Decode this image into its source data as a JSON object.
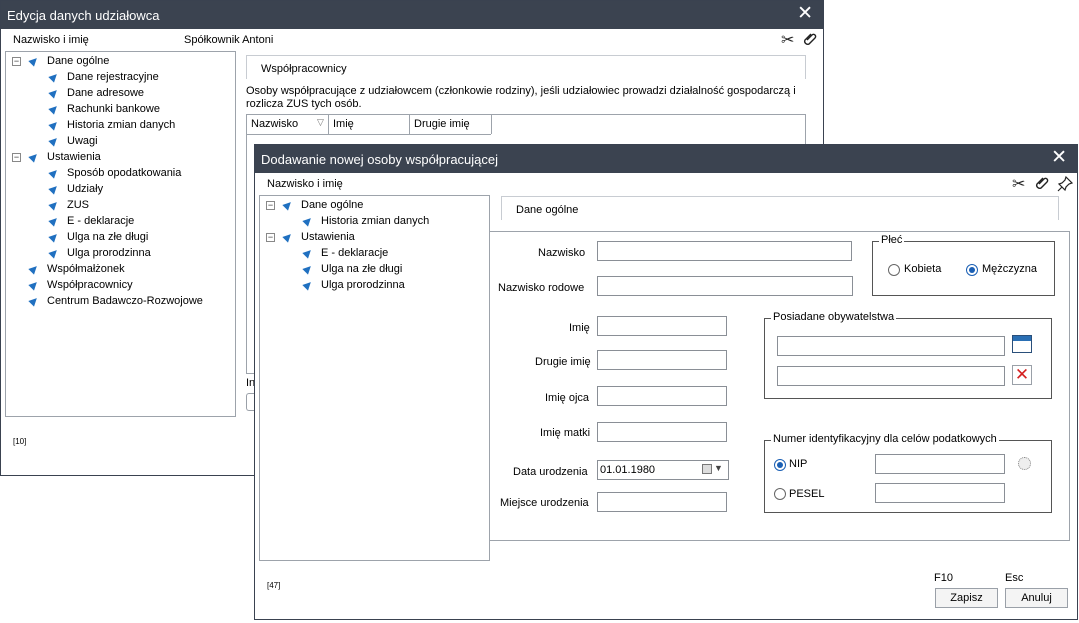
{
  "back_window": {
    "title": "Edycja danych udziałowca",
    "header_label": "Nazwisko i imię",
    "header_value": "Spółkownik Antoni",
    "tree": [
      {
        "label": "Dane ogólne",
        "level": 0
      },
      {
        "label": "Dane rejestracyjne",
        "level": 1
      },
      {
        "label": "Dane adresowe",
        "level": 1
      },
      {
        "label": "Rachunki bankowe",
        "level": 1
      },
      {
        "label": "Historia zmian danych",
        "level": 1
      },
      {
        "label": "Uwagi",
        "level": 1
      },
      {
        "label": "Ustawienia",
        "level": 0
      },
      {
        "label": "Sposób opodatkowania",
        "level": 1
      },
      {
        "label": "Udziały",
        "level": 1
      },
      {
        "label": "ZUS",
        "level": 1
      },
      {
        "label": "E - deklaracje",
        "level": 1
      },
      {
        "label": "Ulga na złe długi",
        "level": 1
      },
      {
        "label": "Ulga prorodzinna",
        "level": 1
      },
      {
        "label": "Współmałżonek",
        "level": 0
      },
      {
        "label": "Współpracownicy",
        "level": 0
      },
      {
        "label": "Centrum Badawczo-Rozwojowe",
        "level": 0
      }
    ],
    "tab_label": "Współpracownicy",
    "description_line1": "Osoby współpracujące z udziałowcem (członkowie rodziny), jeśli udziałowiec prowadzi działalność gospodarczą i",
    "description_line2": "rozlicza ZUS tych osób.",
    "columns": [
      "Nazwisko",
      "Imię",
      "Drugie imię"
    ],
    "truncated_text": "In",
    "status_code": "[10]"
  },
  "front_window": {
    "title": "Dodawanie nowej osoby współpracującej",
    "header_label": "Nazwisko i imię",
    "tree": [
      {
        "label": "Dane ogólne",
        "level": 0
      },
      {
        "label": "Historia zmian danych",
        "level": 1
      },
      {
        "label": "Ustawienia",
        "level": 0
      },
      {
        "label": "E - deklaracje",
        "level": 1
      },
      {
        "label": "Ulga na złe długi",
        "level": 1
      },
      {
        "label": "Ulga prorodzinna",
        "level": 1
      }
    ],
    "tab_label": "Dane ogólne",
    "fields": {
      "nazwisko": {
        "label": "Nazwisko",
        "value": ""
      },
      "nazwisko_rodowe": {
        "label": "Nazwisko rodowe",
        "value": ""
      },
      "imie": {
        "label": "Imię",
        "value": ""
      },
      "drugie_imie": {
        "label": "Drugie imię",
        "value": ""
      },
      "imie_ojca": {
        "label": "Imię ojca",
        "value": ""
      },
      "imie_matki": {
        "label": "Imię matki",
        "value": ""
      },
      "data_urodzenia": {
        "label": "Data urodzenia",
        "value": "01.01.1980"
      },
      "miejsce_urodzenia": {
        "label": "Miejsce urodzenia",
        "value": ""
      }
    },
    "plec": {
      "title": "Płeć",
      "options": [
        "Kobieta",
        "Mężczyzna"
      ],
      "selected": "Mężczyzna"
    },
    "obywatelstwa": {
      "title": "Posiadane obywatelstwa",
      "values": [
        "",
        ""
      ]
    },
    "numer": {
      "title": "Numer identyfikacyjny dla celów podatkowych",
      "options": [
        "NIP",
        "PESEL"
      ],
      "selected": "NIP",
      "nip_value": "",
      "pesel_value": ""
    },
    "status_code": "[47]",
    "save_shortcut": "F10",
    "cancel_shortcut": "Esc",
    "save_label": "Zapisz",
    "cancel_label": "Anuluj"
  },
  "icons": [
    "close-icon",
    "scissors-icon",
    "paperclip-icon",
    "pin-icon",
    "calendar-icon",
    "delete-icon",
    "status-dot-icon",
    "dropdown-arrow-icon"
  ],
  "colors": {
    "titlebar": "#3b4350",
    "accent": "#1a5fb4",
    "tree_triangle": "#2070c0",
    "delete_red": "#d42020"
  }
}
